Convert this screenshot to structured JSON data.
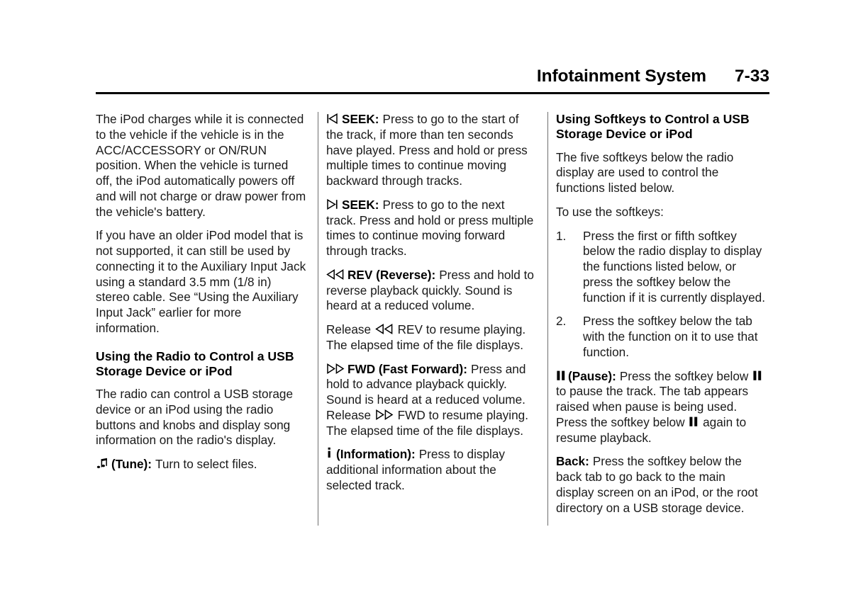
{
  "header": {
    "title": "Infotainment System",
    "page_number": "7-33"
  },
  "column1": {
    "para_ipod_charges": "The iPod charges while it is connected to the vehicle if the vehicle is in the ACC/ACCESSORY or ON/RUN position. When the vehicle is turned off, the iPod automatically powers off and will not charge or draw power from the vehicle's battery.",
    "para_older_ipod": "If you have an older iPod model that is not supported, it can still be used by connecting it to the Auxiliary Input Jack using a standard 3.5 mm (1/8 in) stereo cable. See “Using the Auxiliary Input Jack” earlier for more information.",
    "heading_radio_control": "Using the Radio to Control a USB Storage Device or iPod",
    "para_radio_can_control": "The radio can control a USB storage device or an iPod using the radio buttons and knobs and display song information on the radio's display.",
    "tune": {
      "icon": "music-note-icon",
      "term": "(Tune):",
      "text": "Turn to select files."
    }
  },
  "column2": {
    "seek_back": {
      "icon": "skip-previous-icon",
      "term": "SEEK:",
      "text": "Press to go to the start of the track, if more than ten seconds have played. Press and hold or press multiple times to continue moving backward through tracks."
    },
    "seek_forward": {
      "icon": "skip-next-icon",
      "term": "SEEK:",
      "text": "Press to go to the next track. Press and hold or press multiple times to continue moving forward through tracks."
    },
    "rev": {
      "icon": "rewind-icon",
      "term": "REV (Reverse):",
      "text_part1": "Press and hold to reverse playback quickly. Sound is heard at a reduced volume.",
      "text_part2_before": "Release",
      "text_part2_after": "REV to resume playing. The elapsed time of the file displays."
    },
    "fwd": {
      "icon": "fast-forward-icon",
      "term": "FWD (Fast Forward):",
      "text_before": "Press and hold to advance playback quickly. Sound is heard at a reduced volume. Release",
      "text_after": "FWD to resume playing. The elapsed time of the file displays."
    },
    "information": {
      "icon": "information-icon",
      "term": "(Information):",
      "text": "Press to display additional information about the selected track."
    }
  },
  "column3": {
    "heading_softkeys": "Using Softkeys to Control a USB Storage Device or iPod",
    "para_five_softkeys": "The five softkeys below the radio display are used to control the functions listed below.",
    "para_to_use": "To use the softkeys:",
    "steps": [
      {
        "num": "1.",
        "text": "Press the first or fifth softkey below the radio display to display the functions listed below, or press the softkey below the function if it is currently displayed."
      },
      {
        "num": "2.",
        "text": "Press the softkey below the tab with the function on it to use that function."
      }
    ],
    "pause": {
      "icon": "pause-icon",
      "term": "(Pause):",
      "text_part1": "Press the softkey below",
      "text_part2": "to pause the track. The tab appears raised when pause is being used. Press the softkey below",
      "text_part3": "again to resume playback."
    },
    "back": {
      "term": "Back:",
      "text": "Press the softkey below the back tab to go back to the main display screen on an iPod, or the root directory on a USB storage device."
    }
  },
  "colors": {
    "text": "#1a1a1a",
    "heading": "#000000",
    "rule": "#000000",
    "divider": "#6e6e6e",
    "background": "#ffffff"
  }
}
